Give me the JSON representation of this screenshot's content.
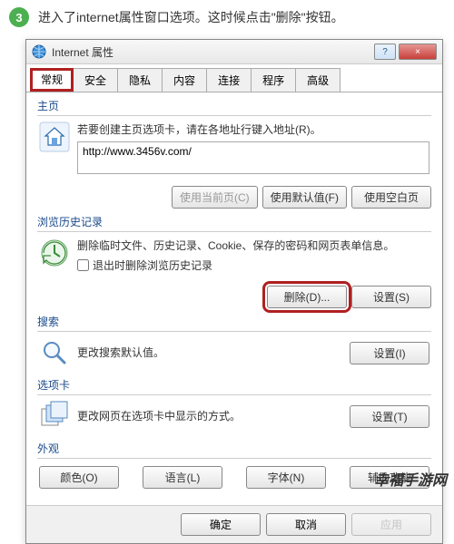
{
  "step": {
    "num": "3",
    "text": "进入了internet属性窗口选项。这时候点击\"删除\"按钮。"
  },
  "titlebar": {
    "title": "Internet 属性",
    "help": "?",
    "close": "×"
  },
  "tabs": [
    "常规",
    "安全",
    "隐私",
    "内容",
    "连接",
    "程序",
    "高级"
  ],
  "homepage": {
    "title": "主页",
    "desc": "若要创建主页选项卡，请在各地址行键入地址(R)。",
    "url": "http://www.3456v.com/",
    "btn_current": "使用当前页(C)",
    "btn_default": "使用默认值(F)",
    "btn_blank": "使用空白页"
  },
  "history": {
    "title": "浏览历史记录",
    "desc": "删除临时文件、历史记录、Cookie、保存的密码和网页表单信息。",
    "chk_label": "退出时删除浏览历史记录",
    "btn_delete": "删除(D)...",
    "btn_settings": "设置(S)"
  },
  "search": {
    "title": "搜索",
    "desc": "更改搜索默认值。",
    "btn_settings": "设置(I)"
  },
  "tabsect": {
    "title": "选项卡",
    "desc": "更改网页在选项卡中显示的方式。",
    "btn_settings": "设置(T)"
  },
  "appearance": {
    "title": "外观",
    "btn_color": "颜色(O)",
    "btn_lang": "语言(L)",
    "btn_font": "字体(N)",
    "btn_access": "辅助功能"
  },
  "footer": {
    "ok": "确定",
    "cancel": "取消",
    "apply": "应用"
  },
  "watermark": "幸福手游网"
}
